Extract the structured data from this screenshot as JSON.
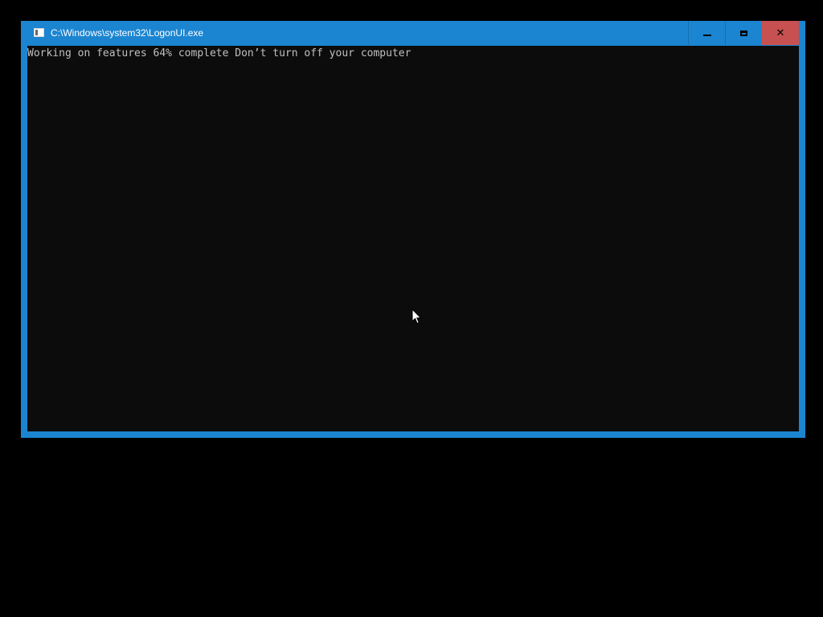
{
  "window": {
    "title": "C:\\Windows\\system32\\LogonUI.exe",
    "icon": "console-window-icon",
    "controls": {
      "minimize_icon": "minimize-icon",
      "maximize_icon": "maximize-icon",
      "close_icon": "close-icon",
      "close_glyph": "✕"
    }
  },
  "console": {
    "output_line": "Working on features 64% complete Don’t turn off your computer",
    "progress_percent": 64
  },
  "colors": {
    "titlebar": "#1b85d1",
    "close_button": "#c75050",
    "console_background": "#0c0c0c",
    "console_text": "#c0c0c0",
    "desktop": "#000000"
  }
}
